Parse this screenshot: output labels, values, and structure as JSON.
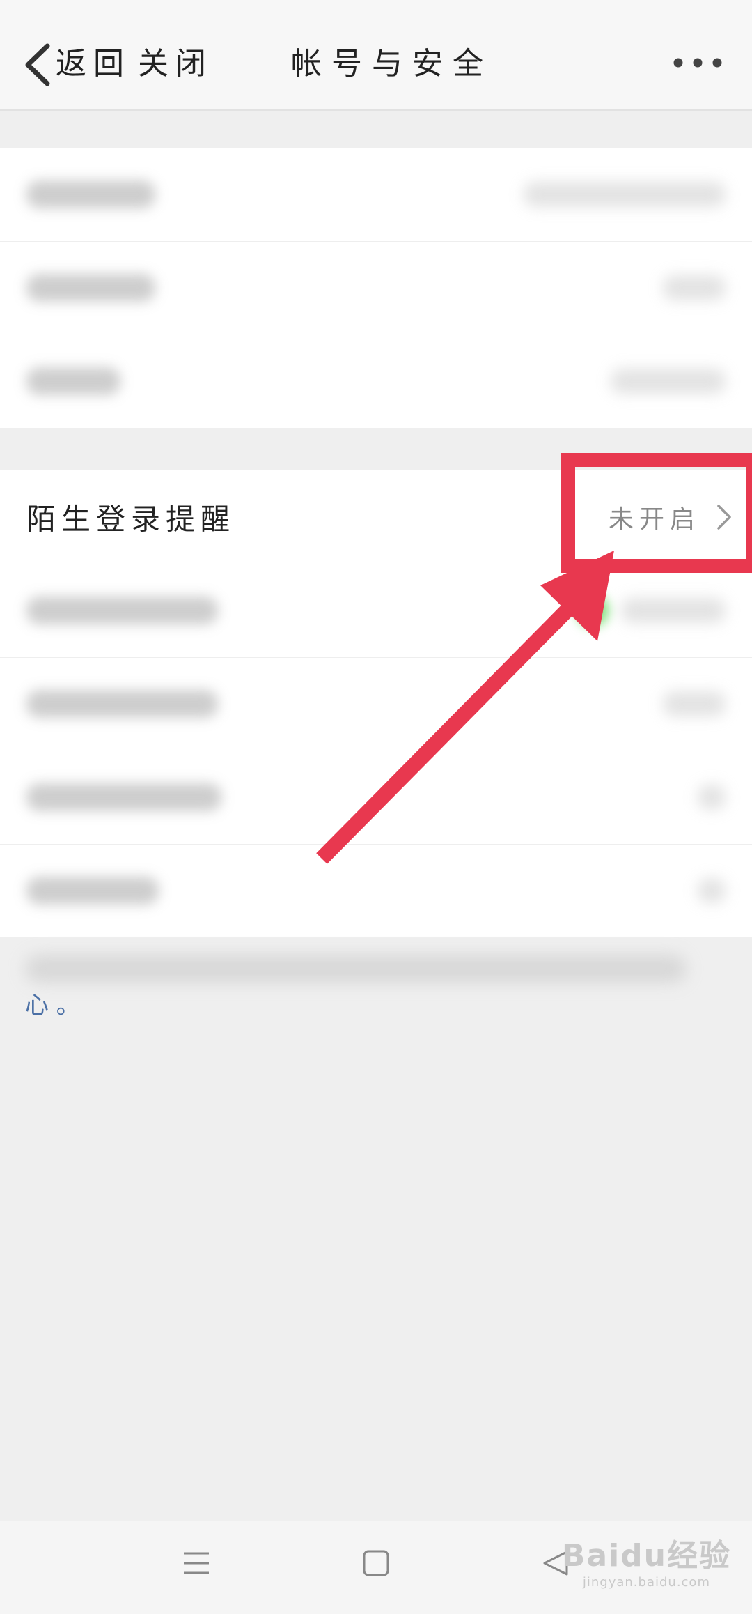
{
  "header": {
    "back_label": "返回",
    "close_label": "关闭",
    "title": "帐号与安全"
  },
  "settings": {
    "stranger_login_label": "陌生登录提醒",
    "stranger_login_value": "未开启"
  },
  "footer_note": {
    "visible_text": "心 。"
  },
  "watermark": {
    "brand": "Baidu经验",
    "url": "jingyan.baidu.com"
  },
  "colors": {
    "annotation_red": "#e8384f",
    "link_blue": "#4a6fa5"
  },
  "icons": {
    "back": "chevron-left-icon",
    "more": "more-dots-icon",
    "row_chevron": "chevron-right-icon",
    "nav_menu": "menu-lines-icon",
    "nav_home": "square-home-icon",
    "nav_back": "triangle-back-icon"
  }
}
